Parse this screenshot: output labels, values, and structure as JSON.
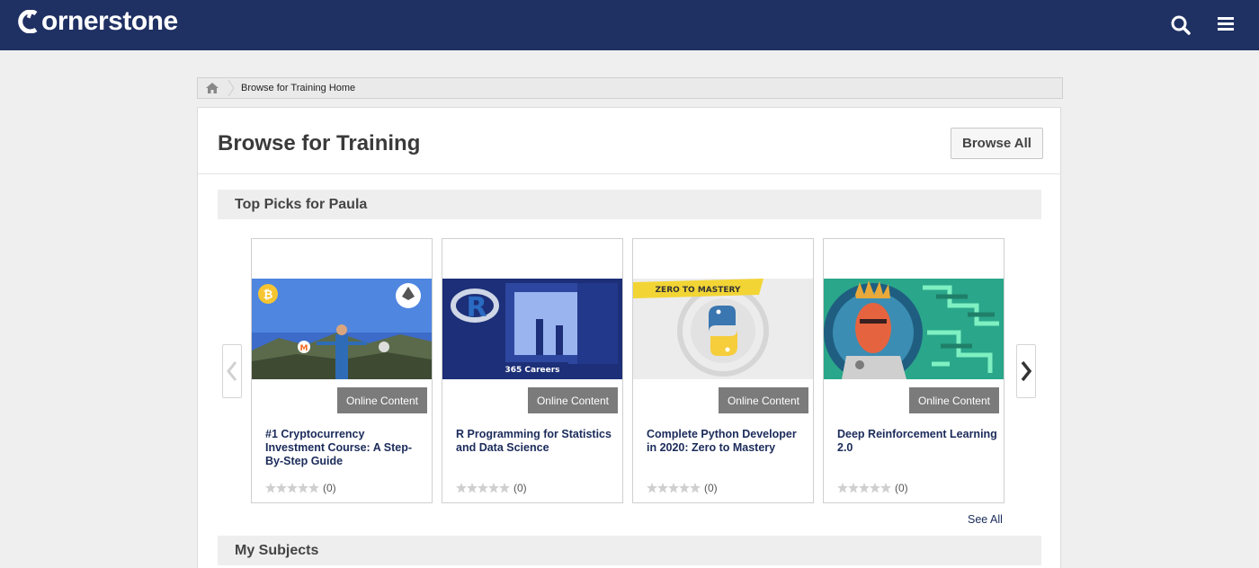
{
  "app": {
    "logo_text": "ornerstone",
    "icons": {
      "logo": "cornerstone-c-icon",
      "search": "search-icon",
      "menu": "hamburger-menu-icon",
      "home": "home-icon"
    },
    "colors": {
      "topbar": "#1f3063",
      "badge": "#7b7b7b",
      "link": "#1b2b5a"
    }
  },
  "breadcrumb": {
    "items": [
      "Browse for Training Home"
    ]
  },
  "header": {
    "title": "Browse for Training",
    "browse_all_label": "Browse All"
  },
  "sections": {
    "top_picks": {
      "title": "Top Picks for Paula",
      "see_all_label": "See All"
    },
    "subjects": {
      "title": "My Subjects"
    }
  },
  "cards": [
    {
      "badge": "Online Content",
      "title": "#1 Cryptocurrency Investment Course: A Step-By-Step Guide",
      "rating_count": "(0)",
      "stars": 0,
      "thumb_icon": "crypto-course-thumbnail"
    },
    {
      "badge": "Online Content",
      "title": "R Programming for Statistics and Data Science",
      "rating_count": "(0)",
      "stars": 0,
      "thumb_icon": "r-programming-thumbnail",
      "thumb_caption": "365 Careers"
    },
    {
      "badge": "Online Content",
      "title": "Complete Python Developer in 2020: Zero to Mastery",
      "rating_count": "(0)",
      "stars": 0,
      "thumb_icon": "python-thumbnail",
      "thumb_caption": "ZERO TO MASTERY"
    },
    {
      "badge": "Online Content",
      "title": "Deep Reinforcement Learning 2.0",
      "rating_count": "(0)",
      "stars": 0,
      "thumb_icon": "deep-rl-thumbnail"
    }
  ]
}
